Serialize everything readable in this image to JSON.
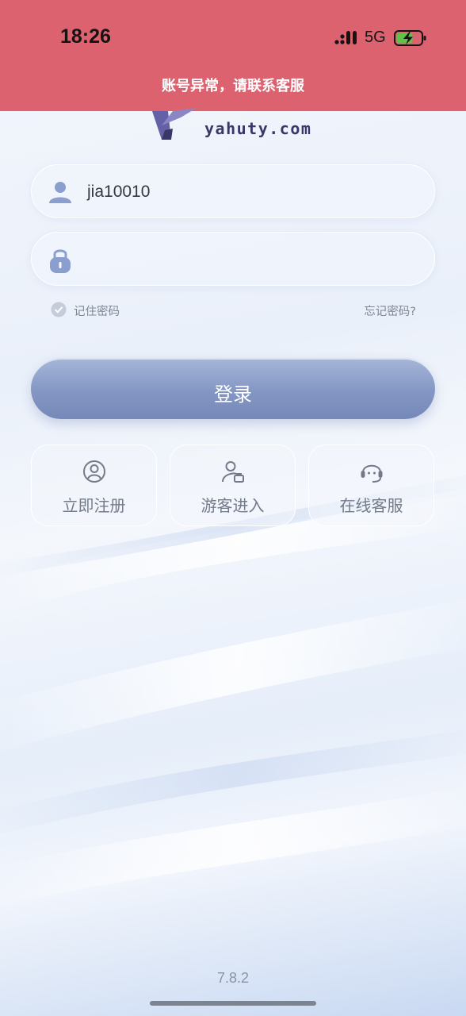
{
  "status_bar": {
    "time": "18:26",
    "network": "5G",
    "signal_icon": "cellular-signal-icon",
    "battery_icon": "battery-charging-icon"
  },
  "alert": {
    "message": "账号异常，请联系客服",
    "background_color": "#dd6270"
  },
  "brand": {
    "logo_text": "yahuty.com",
    "logo_color": "#3a3668"
  },
  "login_form": {
    "username": {
      "icon": "user-icon",
      "value": "jia10010"
    },
    "password": {
      "icon": "lock-icon",
      "value": ""
    },
    "remember_password": {
      "icon": "check-circle-icon",
      "label": "记住密码",
      "checked": true
    },
    "forgot_password": "忘记密码?",
    "login_button": "登录",
    "accent_color": "#8396c3"
  },
  "actions": [
    {
      "icon": "user-circle-icon",
      "label": "立即注册"
    },
    {
      "icon": "guest-user-icon",
      "label": "游客进入"
    },
    {
      "icon": "headset-icon",
      "label": "在线客服"
    }
  ],
  "footer": {
    "version": "7.8.2"
  }
}
